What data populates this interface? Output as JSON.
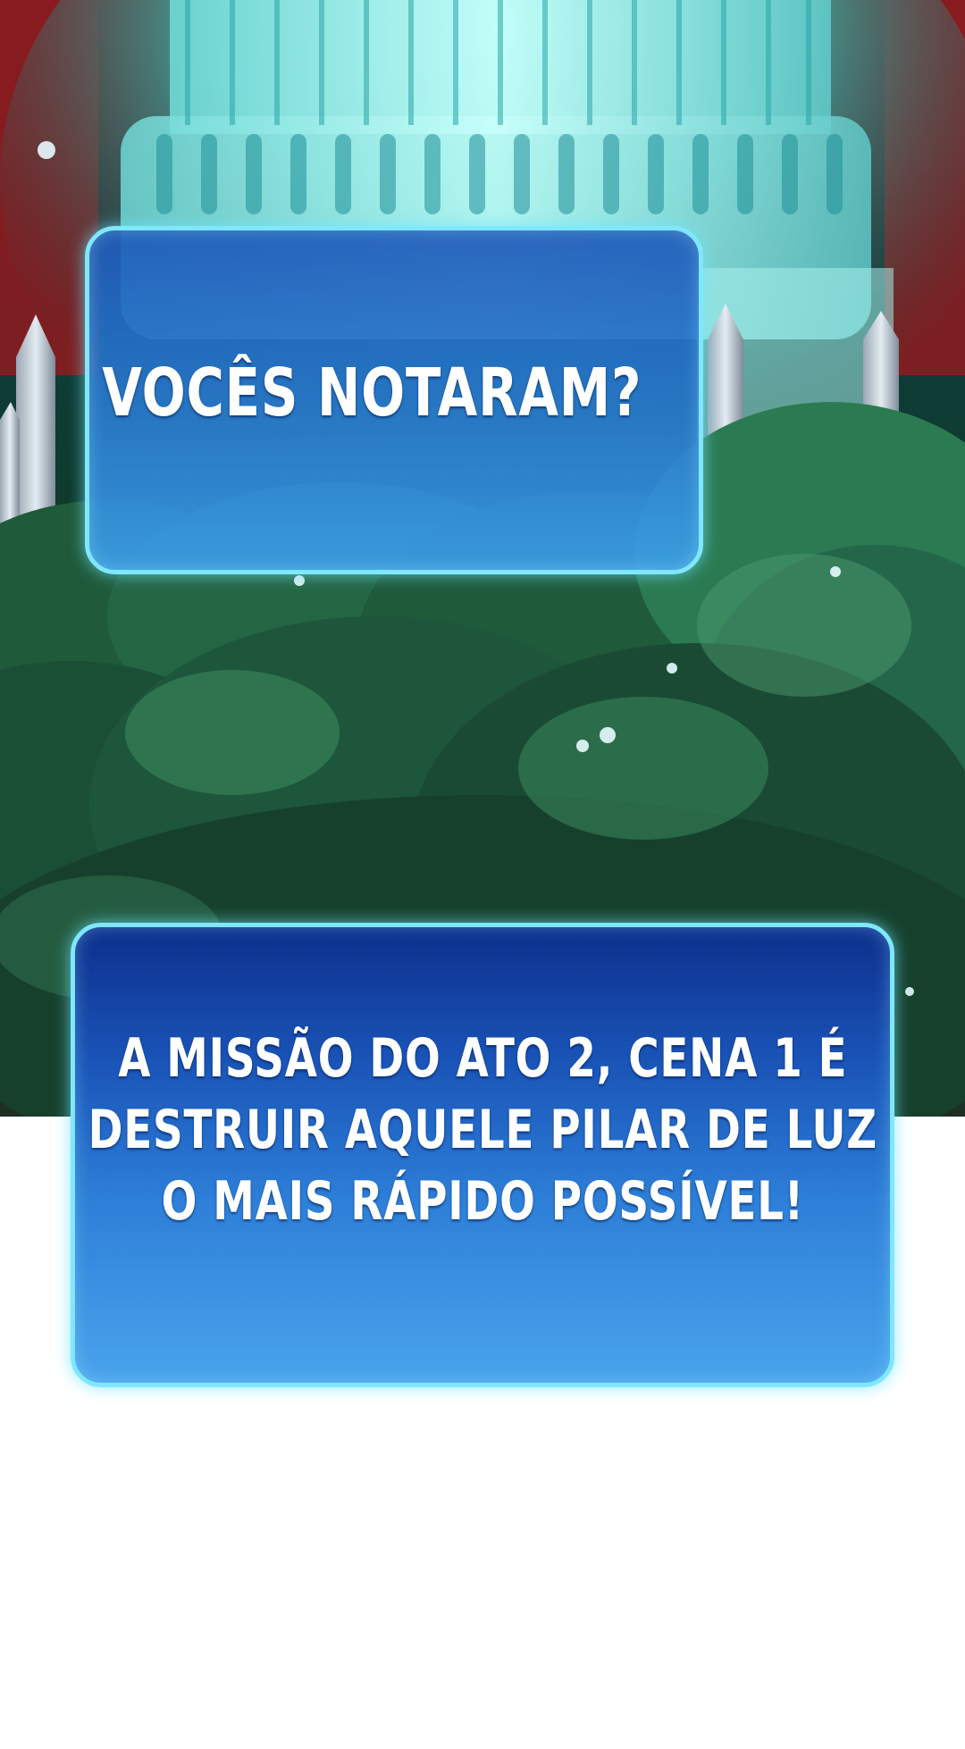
{
  "panel_1": {
    "dialogue": "VOCÊS NOTARAM?"
  },
  "panel_2": {
    "dialogue_lines": [
      "A MISSÃO DO ATO 2, CENA 1 É",
      "DESTRUIR AQUELE PILAR DE LUZ",
      "O MAIS RÁPIDO POSSÍVEL!"
    ]
  },
  "colors": {
    "bubble_border": "#7fe7ff",
    "pillar_glow": "#3ff0e0",
    "sky_red": "#7d1b1f",
    "forest_green": "#1f5a3a"
  }
}
